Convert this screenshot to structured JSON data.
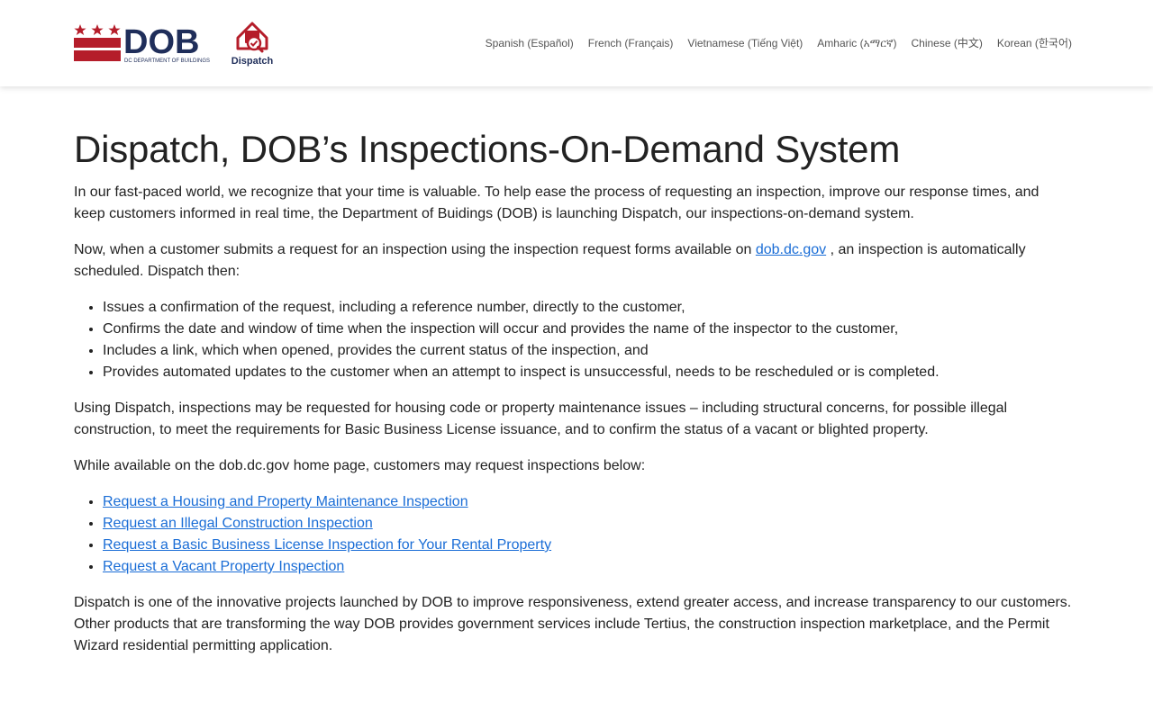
{
  "header": {
    "logo_text": "DOB",
    "logo_subtext": "DC DEPARTMENT OF BUILDINGS",
    "dispatch_logo_text": "Dispatch",
    "languages": [
      "Spanish (Español)",
      "French (Français)",
      "Vietnamese (Tiếng Việt)",
      "Amharic (አማርኛ)",
      "Chinese (中文)",
      "Korean (한국어)"
    ]
  },
  "colors": {
    "brand_red": "#b51d2a",
    "brand_navy": "#1f2e5a",
    "link_blue": "#1a6dd6"
  },
  "content": {
    "title": "Dispatch, DOB’s Inspections-On-Demand System",
    "intro": "In our fast-paced world, we recognize that your time is valuable. To help ease the process of requesting an inspection, improve our response times, and keep customers informed in real time, the Department of Buidings (DOB) is launching Dispatch, our inspections-on-demand system.",
    "p2_before": "Now, when a customer submits a request for an inspection using the inspection request forms available on ",
    "p2_link": "dob.dc.gov",
    "p2_after": " , an inspection is automatically scheduled. Dispatch then:",
    "bullets": [
      "Issues a confirmation of the request, including a reference number, directly to the customer,",
      "Confirms the date and window of time when the inspection will occur and provides the name of the inspector to the customer,",
      "Includes a link, which when opened, provides the current status of the inspection, and",
      "Provides automated updates to the customer when an attempt to inspect is unsuccessful, needs to be rescheduled or is completed."
    ],
    "p3": "Using Dispatch, inspections may be requested for housing code or property maintenance issues – including structural concerns, for possible illegal construction, to meet the requirements for Basic Business License issuance, and to confirm the status of a vacant or blighted property.",
    "p4": "While available on the dob.dc.gov home page, customers may request inspections below:",
    "request_links": [
      "Request a Housing and Property Maintenance Inspection",
      "Request an Illegal Construction Inspection",
      "Request a Basic Business License Inspection for Your Rental Property",
      "Request a Vacant Property Inspection"
    ],
    "p5": "Dispatch is one of the innovative projects launched by DOB to improve responsiveness, extend greater access, and increase transparency to our customers. Other products that are transforming the way DOB provides government services include Tertius, the construction inspection marketplace, and the Permit Wizard residential permitting application."
  }
}
